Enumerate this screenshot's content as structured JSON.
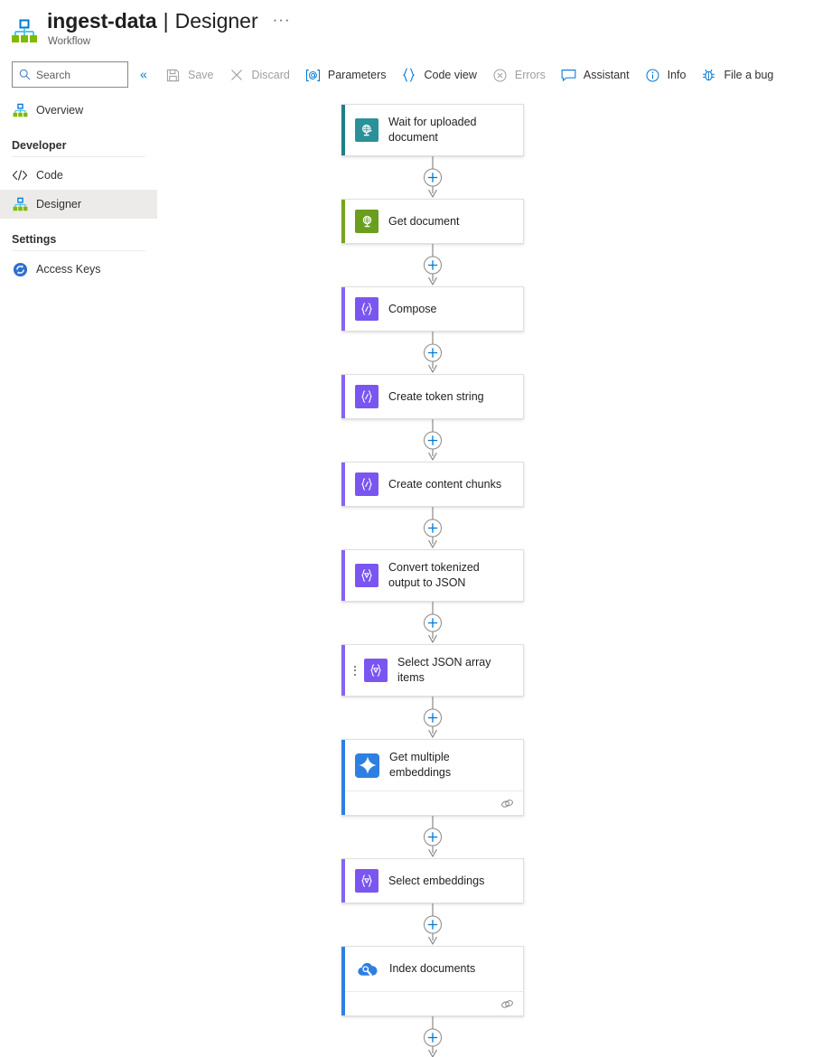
{
  "header": {
    "logo_icon": "sitemap-icon",
    "title": "ingest-data",
    "separator": "|",
    "section": "Designer",
    "more_label": "···",
    "subtitle": "Workflow"
  },
  "search": {
    "placeholder": "Search",
    "icon": "search-icon"
  },
  "collapse": {
    "label": "«"
  },
  "commands": [
    {
      "label": "Save",
      "icon": "save-icon",
      "disabled": true
    },
    {
      "label": "Discard",
      "icon": "close-icon",
      "disabled": true
    },
    {
      "label": "Parameters",
      "icon": "at-bracket-icon",
      "disabled": false
    },
    {
      "label": "Code view",
      "icon": "braces-icon",
      "disabled": false
    },
    {
      "label": "Errors",
      "icon": "error-circle-icon",
      "disabled": true
    },
    {
      "label": "Assistant",
      "icon": "chat-icon",
      "disabled": false
    },
    {
      "label": "Info",
      "icon": "info-circle-icon",
      "disabled": false
    },
    {
      "label": "File a bug",
      "icon": "bug-icon",
      "disabled": false
    }
  ],
  "sidebar": {
    "top_items": [
      {
        "label": "Overview",
        "icon": "sitemap-icon",
        "selected": false
      }
    ],
    "groups": [
      {
        "title": "Developer",
        "items": [
          {
            "label": "Code",
            "icon": "code-icon",
            "selected": false
          },
          {
            "label": "Designer",
            "icon": "sitemap-icon",
            "selected": true
          }
        ]
      },
      {
        "title": "Settings",
        "items": [
          {
            "label": "Access Keys",
            "icon": "key-refresh-icon",
            "selected": false
          }
        ]
      }
    ]
  },
  "canvas": {
    "add_button_icon": "plus-icon",
    "link_icon": "chain-link-icon",
    "nodes": [
      {
        "id": "n1",
        "title": "Wait for uploaded document",
        "icon": "globe-trigger-icon",
        "icon_bg": "#2a9199",
        "strip": "#1f7f87",
        "two_line": true,
        "footer": false,
        "drag_handle": false
      },
      {
        "id": "n2",
        "title": "Get document",
        "icon": "globe-action-icon",
        "icon_bg": "#6a9e1f",
        "strip": "#79a322",
        "two_line": false,
        "footer": false,
        "drag_handle": false
      },
      {
        "id": "n3",
        "title": "Compose",
        "icon": "compose-icon",
        "icon_bg": "#7a56f0",
        "strip": "#8764f0",
        "two_line": false,
        "footer": false,
        "drag_handle": false
      },
      {
        "id": "n4",
        "title": "Create token string",
        "icon": "compose-icon",
        "icon_bg": "#7a56f0",
        "strip": "#8764f0",
        "two_line": false,
        "footer": false,
        "drag_handle": false
      },
      {
        "id": "n5",
        "title": "Create content chunks",
        "icon": "compose-icon",
        "icon_bg": "#7a56f0",
        "strip": "#8764f0",
        "two_line": false,
        "footer": false,
        "drag_handle": false
      },
      {
        "id": "n6",
        "title": "Convert tokenized output to JSON",
        "icon": "select-icon",
        "icon_bg": "#7a56f0",
        "strip": "#8764f0",
        "two_line": true,
        "footer": false,
        "drag_handle": false
      },
      {
        "id": "n7",
        "title": "Select JSON array items",
        "icon": "select-icon",
        "icon_bg": "#7a56f0",
        "strip": "#8764f0",
        "two_line": true,
        "footer": false,
        "drag_handle": true
      },
      {
        "id": "n8",
        "title": "Get multiple embeddings",
        "icon": "sparkle-icon",
        "icon_bg": "#2f7fe0",
        "strip": "#2f7fe0",
        "two_line": true,
        "footer": true,
        "drag_handle": false
      },
      {
        "id": "n9",
        "title": "Select embeddings",
        "icon": "select-icon",
        "icon_bg": "#7a56f0",
        "strip": "#8764f0",
        "two_line": false,
        "footer": false,
        "drag_handle": false
      },
      {
        "id": "n10",
        "title": "Index documents",
        "icon": "cloud-search-icon",
        "icon_bg": "#ffffff",
        "strip": "#2f7fe0",
        "two_line": false,
        "footer": true,
        "drag_handle": false
      }
    ]
  },
  "colors": {
    "accent": "#0078d4",
    "arrow": "#8a8886",
    "card_border": "#e1dfdd",
    "selected_bg": "#edebe9"
  }
}
